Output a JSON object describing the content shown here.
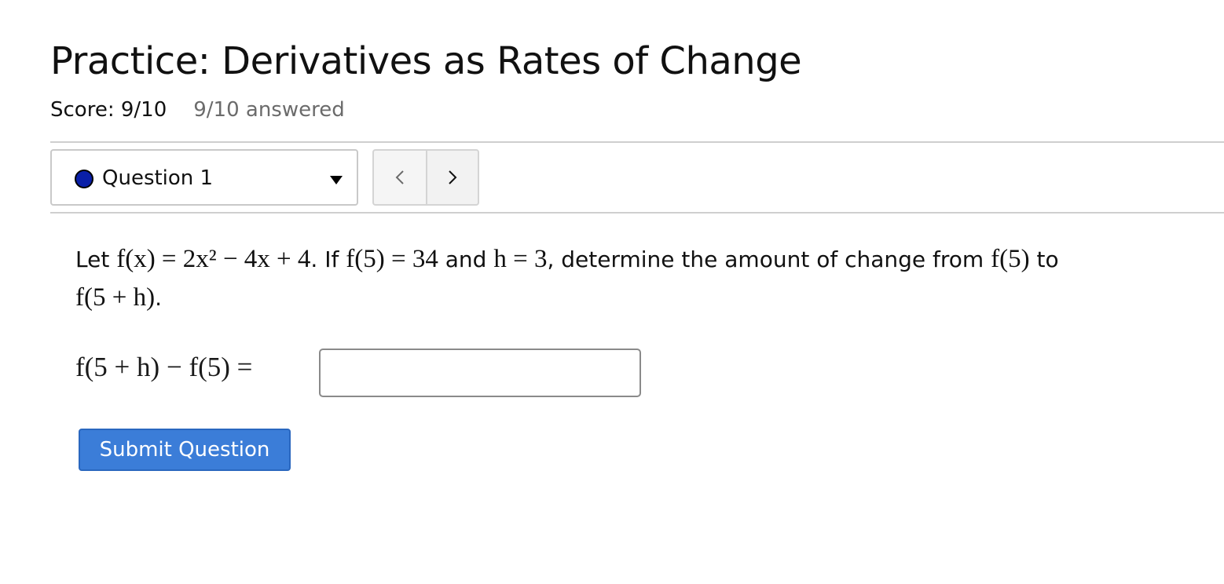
{
  "page": {
    "title": "Practice: Derivatives as Rates of Change",
    "score": "Score: 9/10",
    "answered": "9/10 answered"
  },
  "question_nav": {
    "selected": "Question 1",
    "status_color": "#0a1fa8",
    "prev_icon": "chevron-left-icon",
    "next_icon": "chevron-right-icon"
  },
  "problem": {
    "t_let": "Let ",
    "m_fx": "f(x) = 2x² − 4x + 4",
    "t_if": ". If ",
    "m_f5": "f(5) = 34",
    "t_and": " and ",
    "m_h": "h = 3",
    "t_determine": ", determine the amount of change from ",
    "m_f5b": "f(5)",
    "t_to": " to ",
    "m_f5h": "f(5 + h)",
    "t_period": "."
  },
  "answer": {
    "label": "f(5 + h) − f(5) =",
    "value": "",
    "placeholder": ""
  },
  "submit_label": "Submit Question",
  "colors": {
    "accent": "#3b7dd8",
    "dot": "#0a1fa8"
  }
}
